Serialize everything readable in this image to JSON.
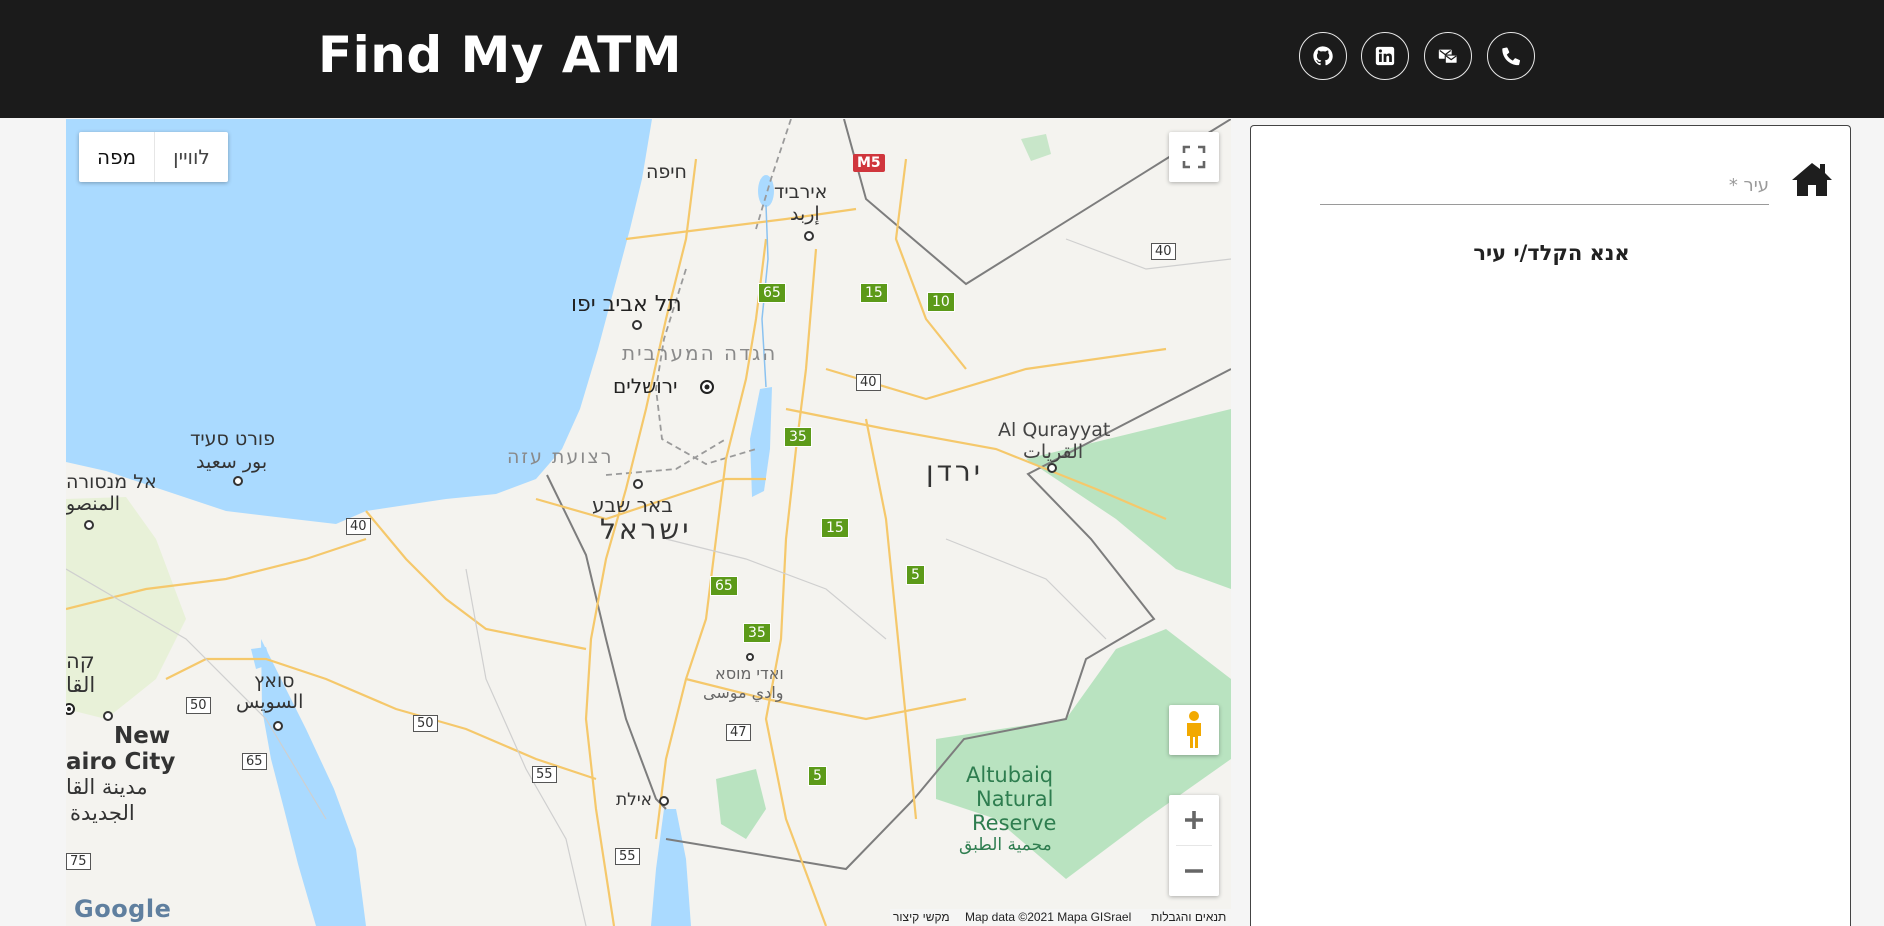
{
  "app": {
    "title": "Find My ATM"
  },
  "social": [
    {
      "name": "github-icon"
    },
    {
      "name": "linkedin-icon"
    },
    {
      "name": "mail-icon"
    },
    {
      "name": "phone-icon"
    }
  ],
  "map": {
    "map_type": {
      "map": "מפה",
      "satellite": "לוויין"
    },
    "labels": {
      "haifa": "חיפה",
      "irbid_he": "אירביד",
      "irbid_ar": "إربد",
      "tel_aviv": "תל אביב יפו",
      "west_bank": "הגדה המערבית",
      "jerusalem": "ירושלים",
      "port_said_he": "פורט סעיד",
      "port_said_ar": "بور سعيد",
      "mansoura_he": "אל מנסורה",
      "mansoura_ar": "المنصو",
      "gaza": "רצועת עזה",
      "beer_sheva": "באר שבע",
      "israel": "ישראל",
      "jordan": "ירדן",
      "al_qurayyat": "Al Qurayyat",
      "al_qurayyat_ar": "القريات",
      "cairo_he": "קה",
      "cairo_ar": "القا",
      "suez_he": "סואץ",
      "suez_ar": "السويس",
      "new_cairo_1": "New",
      "new_cairo_2": "airo City",
      "new_cairo_ar1": "مدينة القا",
      "new_cairo_ar2": "الجديدة",
      "wadi_musa_he": "ואדי מוסא",
      "wadi_musa_ar": "وادي موسى",
      "eilat": "אילת",
      "altubaiq_1": "Altubaiq",
      "altubaiq_2": "Natural",
      "altubaiq_3": "Reserve",
      "altubaiq_ar": "محمية الطبق"
    },
    "shields": {
      "m5": "M5",
      "r40a": "40",
      "r65a": "65",
      "r15a": "15",
      "r10": "10",
      "r40b": "40",
      "r35a": "35",
      "r40c": "40",
      "r15b": "15",
      "r5a": "5",
      "r65b": "65",
      "r35b": "35",
      "r50a": "50",
      "r50b": "50",
      "r65c": "65",
      "r47": "47",
      "r55a": "55",
      "r5b": "5",
      "r55b": "55",
      "r75": "75"
    },
    "google": "Google",
    "shortcuts": "מקשי קיצור",
    "map_data": "Map data ©2021 Mapa GISrael",
    "terms": "תנאים והגבלות"
  },
  "sidebar": {
    "city_placeholder": "עיר *",
    "message": "אנא הקלד/י עיר"
  }
}
